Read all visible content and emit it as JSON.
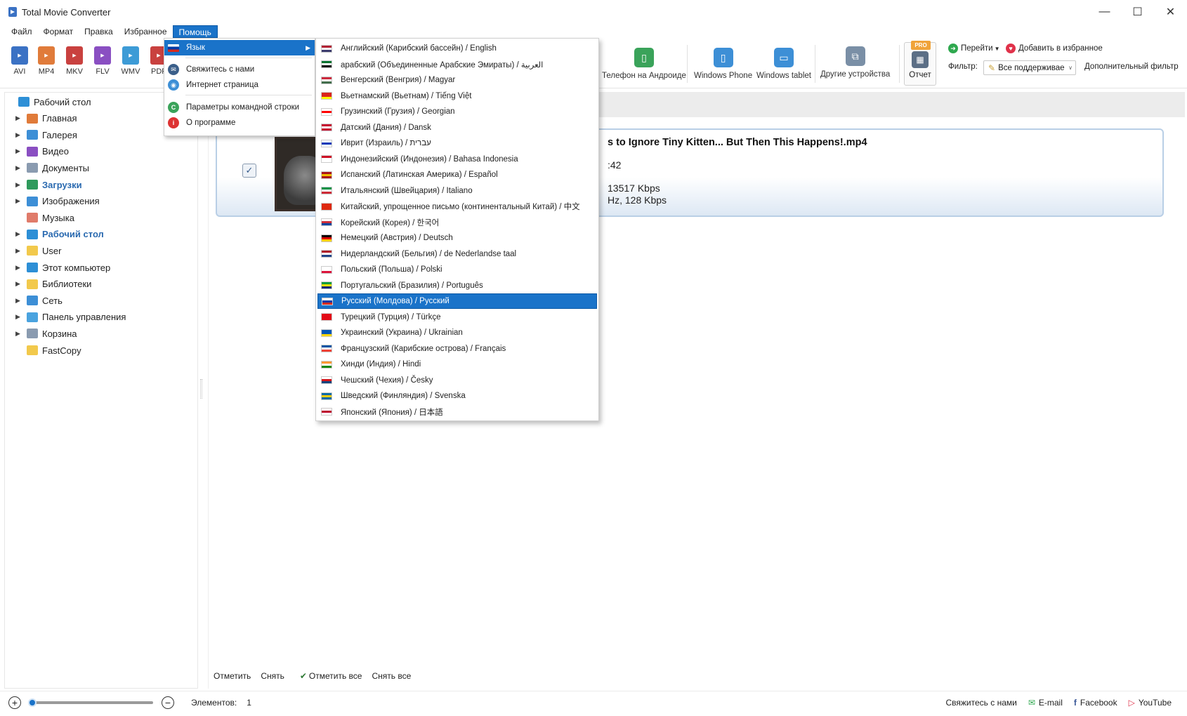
{
  "window": {
    "title": "Total Movie Converter"
  },
  "menubar": [
    "Файл",
    "Формат",
    "Правка",
    "Избранное",
    "Помощь"
  ],
  "toolbar": {
    "formats": [
      {
        "label": "AVI",
        "color": "#3b72c4"
      },
      {
        "label": "MP4",
        "color": "#e07b3a"
      },
      {
        "label": "MKV",
        "color": "#c9413f"
      },
      {
        "label": "FLV",
        "color": "#8a4fc2"
      },
      {
        "label": "WMV",
        "color": "#3d9bd6"
      },
      {
        "label": "PDF",
        "color": "#c9413f"
      }
    ],
    "devices": [
      {
        "label": "Телефон на Андроиде",
        "color": "#3aa35a"
      },
      {
        "label": "Windows Phone",
        "color": "#3d8fd6"
      },
      {
        "label": "Windows tablet",
        "color": "#3d8fd6"
      },
      {
        "label": "Другие устройства",
        "color": "#7a8fa6"
      }
    ],
    "report": "Отчет",
    "pro": "PRO",
    "goto": "Перейти",
    "add_favorite": "Добавить в избранное",
    "filter_label": "Фильтр:",
    "filter_value": "Все поддерживае",
    "extra_filter": "Дополнительный фильтр"
  },
  "tree": [
    {
      "label": "Рабочий стол",
      "arrow": false,
      "indent": 0,
      "bold": false,
      "color": "#2d8fd6"
    },
    {
      "label": "Главная",
      "arrow": true,
      "indent": 1,
      "bold": false,
      "color": "#e07b3a"
    },
    {
      "label": "Галерея",
      "arrow": true,
      "indent": 1,
      "bold": false,
      "color": "#3d8fd6"
    },
    {
      "label": "Видео",
      "arrow": true,
      "indent": 1,
      "bold": false,
      "color": "#8a4fc2"
    },
    {
      "label": "Документы",
      "arrow": true,
      "indent": 1,
      "bold": false,
      "color": "#8a9bb0"
    },
    {
      "label": "Загрузки",
      "arrow": true,
      "indent": 1,
      "bold": true,
      "color": "#2f9a5c"
    },
    {
      "label": "Изображения",
      "arrow": true,
      "indent": 1,
      "bold": false,
      "color": "#3d8fd6"
    },
    {
      "label": "Музыка",
      "arrow": false,
      "indent": 1,
      "bold": false,
      "color": "#e07b6a"
    },
    {
      "label": "Рабочий стол",
      "arrow": true,
      "indent": 1,
      "bold": true,
      "color": "#2d8fd6"
    },
    {
      "label": "User",
      "arrow": true,
      "indent": 1,
      "bold": false,
      "color": "#f2c94c"
    },
    {
      "label": "Этот компьютер",
      "arrow": true,
      "indent": 1,
      "bold": false,
      "color": "#2d8fd6"
    },
    {
      "label": "Библиотеки",
      "arrow": true,
      "indent": 1,
      "bold": false,
      "color": "#f2c94c"
    },
    {
      "label": "Сеть",
      "arrow": true,
      "indent": 1,
      "bold": false,
      "color": "#3d8fd6"
    },
    {
      "label": "Панель управления",
      "arrow": true,
      "indent": 1,
      "bold": false,
      "color": "#4aa3df"
    },
    {
      "label": "Корзина",
      "arrow": true,
      "indent": 1,
      "bold": false,
      "color": "#8a9bb0"
    },
    {
      "label": "FastCopy",
      "arrow": false,
      "indent": 1,
      "bold": false,
      "color": "#f2c94c"
    }
  ],
  "file": {
    "title": "s to Ignore Tiny Kitten... But Then This Happens!.mp4",
    "line1": ":42",
    "line2": "13517 Kbps",
    "line3": "Hz, 128 Kbps"
  },
  "help_menu": [
    {
      "label": "Язык",
      "icon_color": "#d33",
      "submenu": true,
      "highlight": true
    },
    {
      "label": "Свяжитесь с нами",
      "icon_color": "#3b5f8a"
    },
    {
      "label": "Интернет страница",
      "icon_color": "#3d8fd6"
    },
    {
      "label": "Параметры командной строки",
      "icon_color": "#3aa35a"
    },
    {
      "label": "О программе",
      "icon_color": "#d33"
    }
  ],
  "languages": [
    {
      "label": "Английский (Карибский бассейн) / English",
      "flag": [
        "#b22234",
        "#ffffff",
        "#3c3b6e"
      ]
    },
    {
      "label": "арабский (Объединенные Арабские Эмираты) / العربية",
      "flag": [
        "#00732f",
        "#ffffff",
        "#000000"
      ]
    },
    {
      "label": "Венгерский (Венгрия) / Magyar",
      "flag": [
        "#cd2a3e",
        "#ffffff",
        "#436f4d"
      ]
    },
    {
      "label": "Вьетнамский (Вьетнам) / Tiếng Việt",
      "flag": [
        "#da251d",
        "#da251d",
        "#ffff00"
      ]
    },
    {
      "label": "Грузинский (Грузия) / Georgian",
      "flag": [
        "#ffffff",
        "#ff0000",
        "#ffffff"
      ]
    },
    {
      "label": "Датский (Дания) / Dansk",
      "flag": [
        "#c60c30",
        "#ffffff",
        "#c60c30"
      ]
    },
    {
      "label": "Иврит (Израиль) / עברית",
      "flag": [
        "#ffffff",
        "#0038b8",
        "#ffffff"
      ]
    },
    {
      "label": "Индонезийский (Индонезия) / Bahasa Indonesia",
      "flag": [
        "#ce1126",
        "#ffffff",
        "#ffffff"
      ]
    },
    {
      "label": "Испанский (Латинская Америка) / Español",
      "flag": [
        "#aa151b",
        "#f1bf00",
        "#aa151b"
      ]
    },
    {
      "label": "Итальянский (Швейцария) / Italiano",
      "flag": [
        "#009246",
        "#ffffff",
        "#ce2b37"
      ]
    },
    {
      "label": "Китайский, упрощенное письмо (континентальный Китай) / 中文",
      "flag": [
        "#de2910",
        "#de2910",
        "#de2910"
      ]
    },
    {
      "label": "Корейский (Корея) / 한국어",
      "flag": [
        "#ffffff",
        "#cd2e3a",
        "#0047a0"
      ]
    },
    {
      "label": "Немецкий (Австрия) / Deutsch",
      "flag": [
        "#000000",
        "#dd0000",
        "#ffce00"
      ]
    },
    {
      "label": "Нидерландский (Бельгия) / de Nederlandse taal",
      "flag": [
        "#ae1c28",
        "#ffffff",
        "#21468b"
      ]
    },
    {
      "label": "Польский (Польша) / Polski",
      "flag": [
        "#ffffff",
        "#ffffff",
        "#dc143c"
      ]
    },
    {
      "label": "Португальский (Бразилия) / Português",
      "flag": [
        "#009c3b",
        "#ffdf00",
        "#002776"
      ]
    },
    {
      "label": "Русский (Молдова) / Русский",
      "flag": [
        "#ffffff",
        "#0039a6",
        "#d52b1e"
      ],
      "highlight": true
    },
    {
      "label": "Турецкий (Турция) / Türkçe",
      "flag": [
        "#e30a17",
        "#e30a17",
        "#e30a17"
      ]
    },
    {
      "label": "Украинский (Украина) / Ukrainian",
      "flag": [
        "#0057b7",
        "#0057b7",
        "#ffd700"
      ]
    },
    {
      "label": "Французский (Карибские острова) / Français",
      "flag": [
        "#0055a4",
        "#ffffff",
        "#ef4135"
      ]
    },
    {
      "label": "Хинди (Индия) / Hindi",
      "flag": [
        "#ff9933",
        "#ffffff",
        "#138808"
      ]
    },
    {
      "label": "Чешский (Чехия) / Česky",
      "flag": [
        "#ffffff",
        "#d7141a",
        "#11457e"
      ]
    },
    {
      "label": "Шведский (Финляндия) / Svenska",
      "flag": [
        "#006aa7",
        "#fecc00",
        "#006aa7"
      ]
    },
    {
      "label": "Японский (Япония) / 日本語",
      "flag": [
        "#ffffff",
        "#bc002d",
        "#ffffff"
      ]
    }
  ],
  "bottom_bar": {
    "mark": "Отметить",
    "unmark": "Снять",
    "mark_all": "Отметить все",
    "unmark_all": "Снять все"
  },
  "status": {
    "items_label": "Элементов:",
    "items_count": "1",
    "contact": "Свяжитесь с нами",
    "email": "E-mail",
    "facebook": "Facebook",
    "youtube": "YouTube"
  }
}
